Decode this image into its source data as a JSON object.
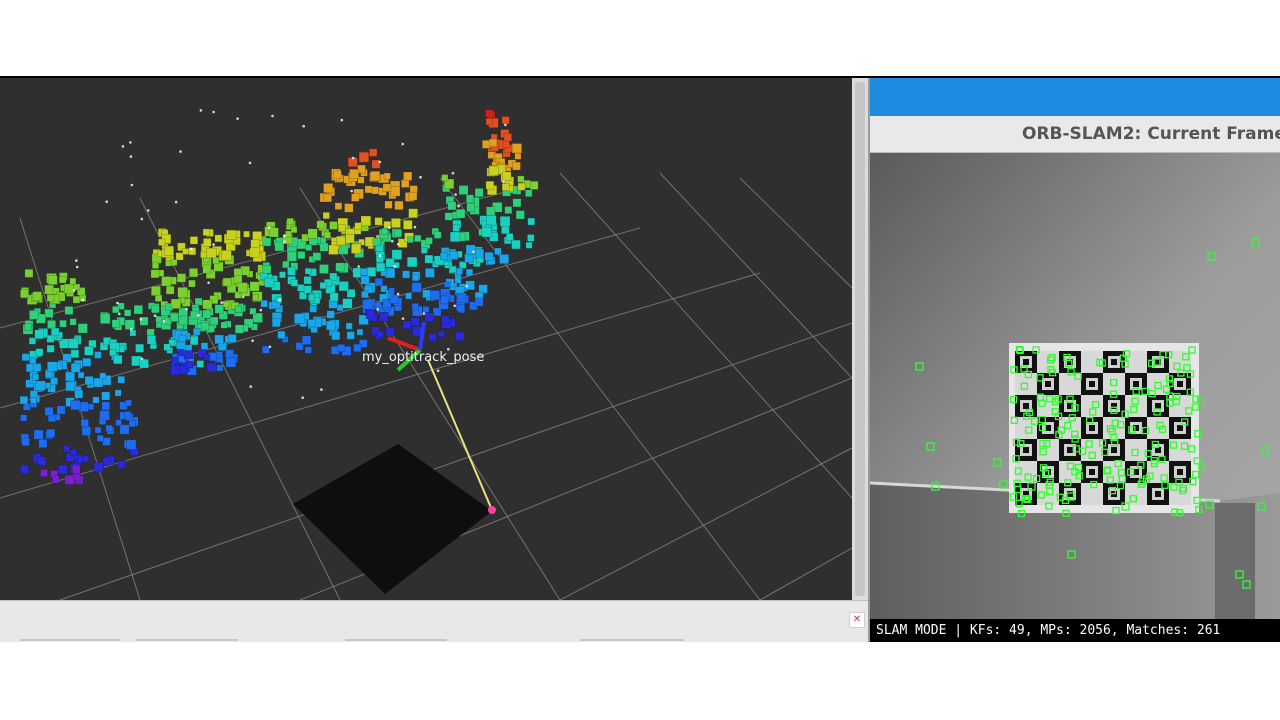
{
  "rviz": {
    "pose_label": "my_optitrack_pose"
  },
  "orb_window": {
    "title": "ORB-SLAM2: Current Frame",
    "status_text": "SLAM MODE |  KFs: 49, MPs: 2056, Matches: 261"
  },
  "controls": {
    "close_glyph": "✕"
  },
  "colors": {
    "viewport_bg": "#2f2f2f",
    "grid": "#8a8a8a",
    "accent_blue": "#1e8be0",
    "feature_green": "#2fff2f"
  }
}
